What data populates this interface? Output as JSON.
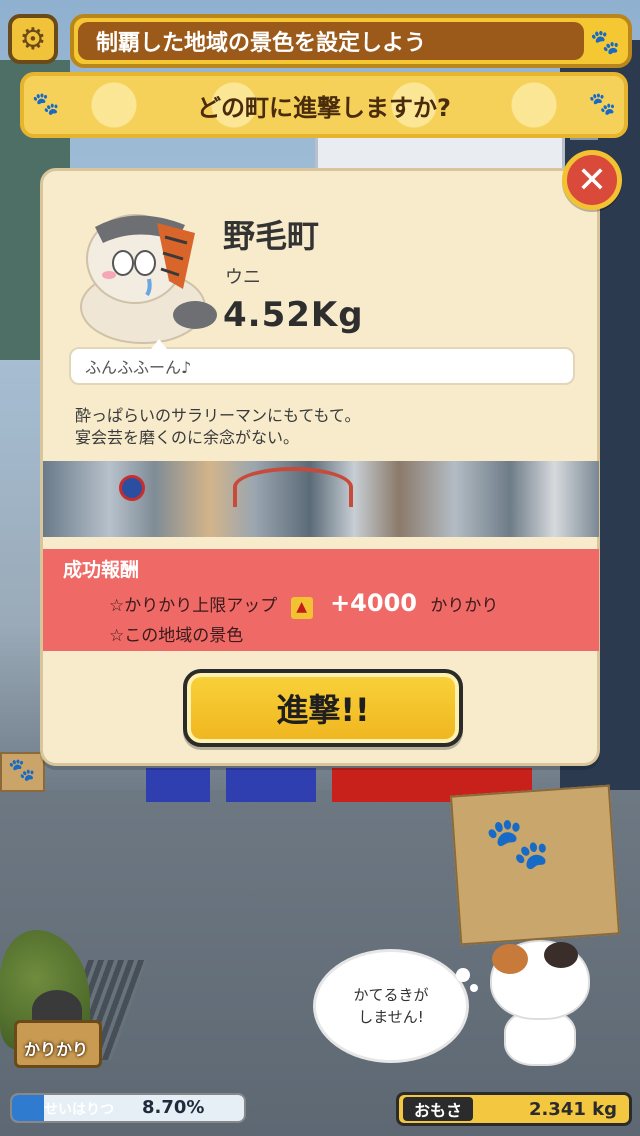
{
  "header": {
    "settings_icon": "gear-icon",
    "banner_text": "制覇した地域の景色を設定しよう",
    "banner_icon": "paw-icon",
    "question": "どの町に進撃しますか?"
  },
  "dialog": {
    "close_icon": "close-icon",
    "boss": {
      "town": "野毛町",
      "owner": "ウニ",
      "weight": "4.52Kg",
      "speech": "ふんふふーん♪",
      "description_line1": "酔っぱらいのサラリーマンにもてもて。",
      "description_line2": "宴会芸を磨くのに余念がない。"
    },
    "reward": {
      "title": "成功報酬",
      "line1_prefix": "☆かりかり上限アップ",
      "line1_icon": "up-arrow-icon",
      "line1_amount": "+4000",
      "line1_unit": "かりかり",
      "line2": "☆この地域の景色"
    },
    "attack_button": "進撃!!"
  },
  "bottom": {
    "karikari_label": "かりかり",
    "conquest_label": "せいはりつ",
    "conquest_value": "8.70%",
    "conquest_fraction": 0.087,
    "cat_speech_line1": "かてるきが",
    "cat_speech_line2": "しません!",
    "weight_label": "おもさ",
    "weight_value": "2.341 kg"
  },
  "colors": {
    "accent_yellow": "#f4c733",
    "banner_brown": "#9b5a1a",
    "reward_red": "#ef6a66",
    "close_red": "#d94a3b",
    "conquest_blue": "#2f7bd0"
  }
}
